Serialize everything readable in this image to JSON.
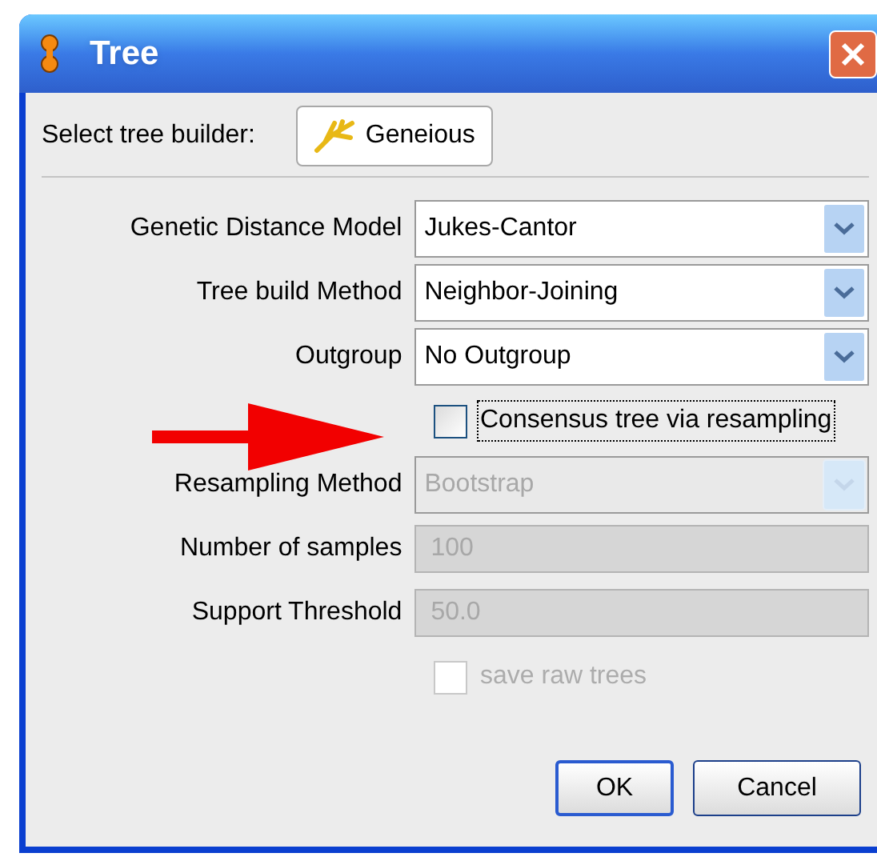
{
  "window": {
    "title": "Tree"
  },
  "builder": {
    "label": "Select tree builder:",
    "button": "Geneious"
  },
  "fields": [
    {
      "kind": "dropdown",
      "label": "Genetic Distance Model",
      "value": "Jukes-Cantor",
      "disabled": false
    },
    {
      "kind": "dropdown",
      "label": "Tree build Method",
      "value": "Neighbor-Joining",
      "disabled": false
    },
    {
      "kind": "dropdown",
      "label": "Outgroup",
      "value": "No Outgroup",
      "disabled": false
    },
    {
      "kind": "checkbox",
      "label": "Consensus tree via resampling",
      "checked": false,
      "disabled": false,
      "focused": true
    },
    {
      "kind": "dropdown",
      "label": "Resampling Method",
      "value": "Bootstrap",
      "disabled": true
    },
    {
      "kind": "text",
      "label": "Number of samples",
      "value": "100",
      "disabled": true
    },
    {
      "kind": "text",
      "label": "Support Threshold",
      "value": "50.0",
      "disabled": true
    },
    {
      "kind": "checkbox",
      "label": "save raw trees",
      "checked": false,
      "disabled": true,
      "focused": false
    }
  ],
  "buttons": [
    "OK",
    "Cancel"
  ]
}
